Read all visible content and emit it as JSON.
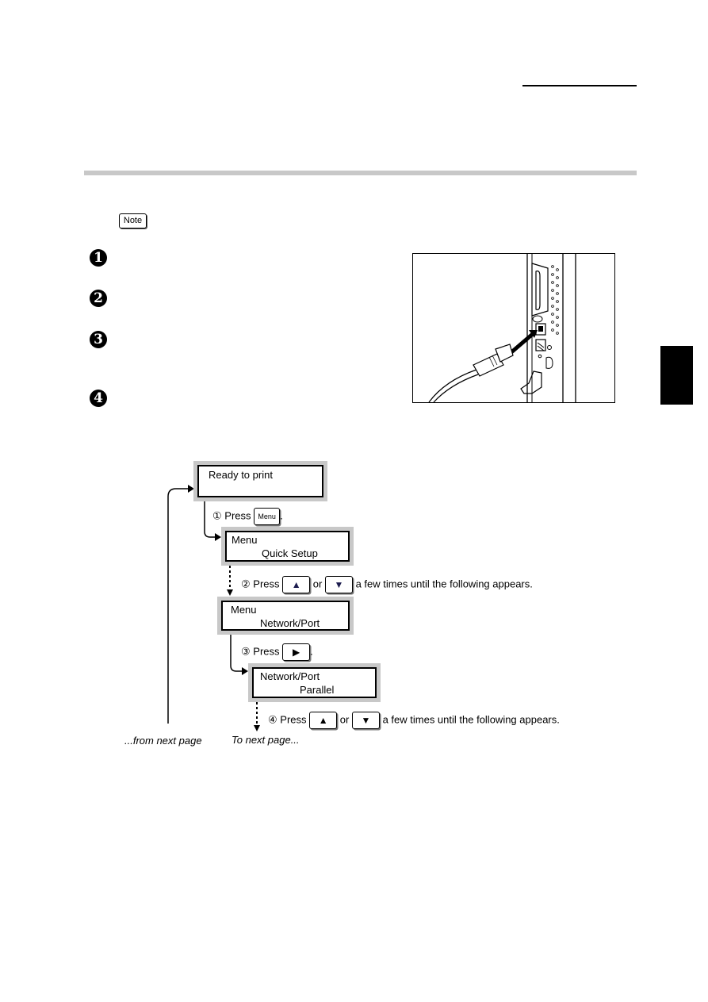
{
  "page": {
    "note_label": "Note",
    "step_markers": [
      "1",
      "2",
      "3",
      "4"
    ],
    "figure": {
      "name": "usb-cable-connection-illustration",
      "description": "USB cable being plugged into printer rear interface port"
    }
  },
  "flow": {
    "displays": [
      {
        "line1": "Ready to print",
        "line2": ""
      },
      {
        "line1": "Menu",
        "line2": "Quick Setup"
      },
      {
        "line1": "Menu",
        "line2": "Network/Port"
      },
      {
        "line1": "Network/Port",
        "line2": "Parallel"
      }
    ],
    "steps": [
      {
        "marker": "①",
        "press": "Press",
        "keys": [
          "Menu"
        ],
        "suffix": "."
      },
      {
        "marker": "②",
        "press": "Press",
        "keys": [
          "▲",
          "▼"
        ],
        "joiner": "or",
        "suffix": "a few times until the following appears."
      },
      {
        "marker": "③",
        "press": "Press",
        "keys": [
          "▶"
        ],
        "suffix": "."
      },
      {
        "marker": "④",
        "press": "Press",
        "keys": [
          "▲",
          "▼"
        ],
        "joiner": "or",
        "suffix": "a few times until the following appears."
      }
    ],
    "from_next_page": "...from next page",
    "to_next_page": "To next page..."
  },
  "colors": {
    "rule_gray": "#c8c8c8",
    "tab_black": "#000000",
    "arrow_key_navy": "#1c1c4e"
  }
}
